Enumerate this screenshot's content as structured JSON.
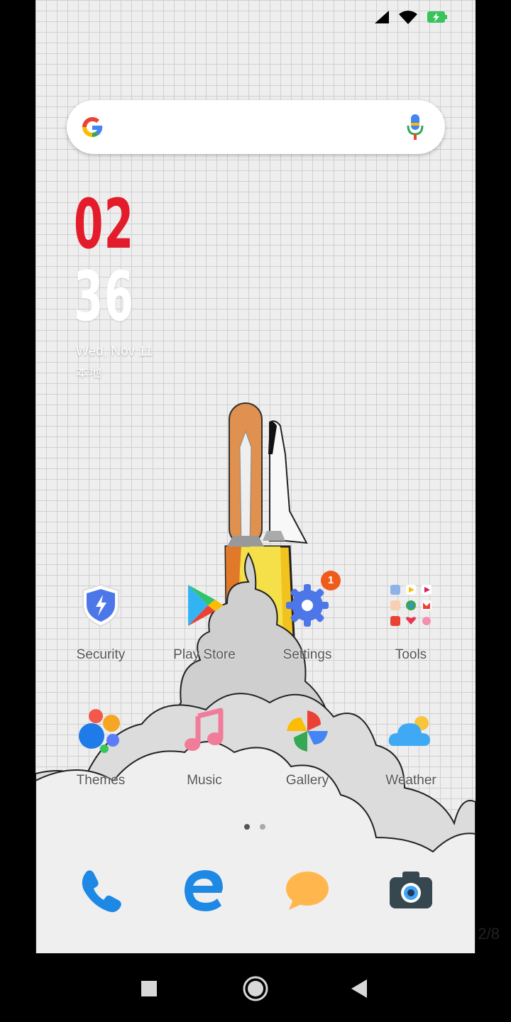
{
  "search": {
    "brand": "G"
  },
  "clock": {
    "hour": "02",
    "minute": "36",
    "date": "Wed, Nov 11",
    "location": "本地"
  },
  "apps_row1": [
    {
      "label": "Security",
      "icon": "shield-bolt-icon"
    },
    {
      "label": "Play Store",
      "icon": "play-store-icon"
    },
    {
      "label": "Settings",
      "icon": "gear-icon",
      "badge": "1"
    },
    {
      "label": "Tools",
      "icon": "folder-grid-icon"
    }
  ],
  "apps_row2": [
    {
      "label": "Themes",
      "icon": "themes-dots-icon"
    },
    {
      "label": "Music",
      "icon": "music-note-icon"
    },
    {
      "label": "Gallery",
      "icon": "pinwheel-icon"
    },
    {
      "label": "Weather",
      "icon": "cloud-sun-icon"
    }
  ],
  "dock": [
    {
      "icon": "phone-icon"
    },
    {
      "icon": "browser-e-icon"
    },
    {
      "icon": "messages-icon"
    },
    {
      "icon": "camera-icon"
    }
  ],
  "pager": {
    "count_text": "2/8"
  },
  "colors": {
    "clock_hour": "#e31b2a",
    "badge": "#f05a1a",
    "page_dot_active": "#555555",
    "page_dot_inactive": "#aaaaaa"
  }
}
